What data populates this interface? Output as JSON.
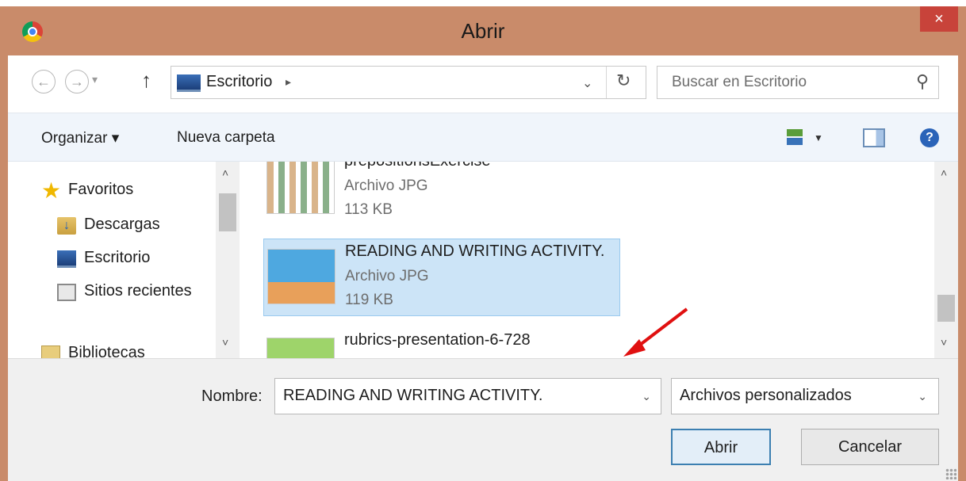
{
  "window": {
    "title": "Abrir",
    "close_label": "×"
  },
  "nav": {
    "back_icon": "←",
    "forward_icon": "→",
    "history_drop": "▾",
    "up_icon": "↑",
    "breadcrumb": "Escritorio",
    "breadcrumb_arrow": "▸",
    "address_drop": "⌄",
    "refresh_icon": "↻",
    "search_placeholder": "Buscar en Escritorio",
    "search_icon": "⚲"
  },
  "toolbar": {
    "organize_label": "Organizar ▾",
    "new_folder_label": "Nueva carpeta",
    "view_drop": "▼",
    "help_label": "?"
  },
  "sidebar": {
    "items": [
      {
        "label": "Favoritos",
        "icon": "star-icon"
      },
      {
        "label": "Descargas",
        "icon": "downloads-folder-icon"
      },
      {
        "label": "Escritorio",
        "icon": "desktop-icon"
      },
      {
        "label": "Sitios recientes",
        "icon": "recent-places-icon"
      },
      {
        "label": "Bibliotecas",
        "icon": "libraries-icon"
      }
    ],
    "scroll_up": "˄",
    "scroll_down": "˅"
  },
  "files": [
    {
      "name": "prepositionsExercise",
      "type": "Archivo JPG",
      "size": "113 KB",
      "selected": false
    },
    {
      "name": "READING AND WRITING ACTIVITY.",
      "type": "Archivo JPG",
      "size": "119 KB",
      "selected": true
    },
    {
      "name": "rubrics-presentation-6-728",
      "type": "",
      "size": "",
      "selected": false
    }
  ],
  "file_scroll": {
    "up": "˄",
    "down": "˅"
  },
  "bottom": {
    "name_label": "Nombre:",
    "name_value": "READING AND WRITING ACTIVITY.",
    "name_drop": "⌄",
    "filetype_value": "Archivos personalizados",
    "filetype_drop": "⌄",
    "open_label": "Abrir",
    "cancel_label": "Cancelar"
  },
  "colors": {
    "titlebar": "#c98b6a",
    "close": "#c8433a",
    "selection": "#cce4f7",
    "annotation_arrow": "#e01010"
  }
}
